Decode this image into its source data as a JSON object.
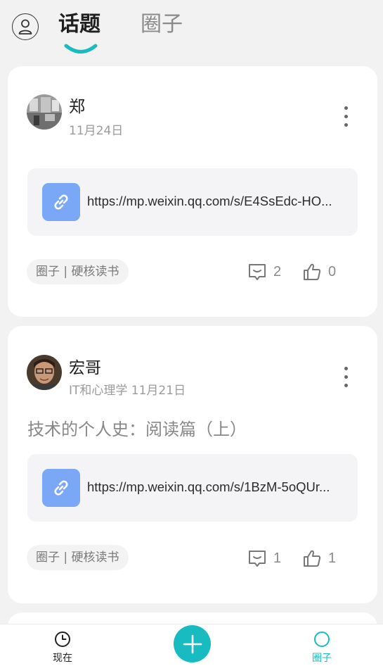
{
  "header": {
    "tabs": [
      {
        "label": "话题",
        "active": true
      },
      {
        "label": "圈子",
        "active": false
      }
    ],
    "profile_icon": "user-icon"
  },
  "posts": [
    {
      "author": "郑",
      "meta": "11月24日",
      "title": "",
      "link_url": "https://mp.weixin.qq.com/s/E4SsEdc-HO...",
      "circle_tag": "圈子 | 硬核读书",
      "comments": "2",
      "likes": "0"
    },
    {
      "author": "宏哥",
      "meta": "IT和心理学 11月21日",
      "title": "技术的个人史：阅读篇（上）",
      "link_url": "https://mp.weixin.qq.com/s/1BzM-5oQUr...",
      "circle_tag": "圈子 | 硬核读书",
      "comments": "1",
      "likes": "1"
    }
  ],
  "bottom_nav": {
    "items": [
      {
        "label": "现在",
        "icon": "clock-icon",
        "active": false
      },
      {
        "label": "圈子",
        "icon": "circle-icon",
        "active": true
      }
    ],
    "add_icon": "plus-icon"
  },
  "colors": {
    "accent": "#18bcc0",
    "link_icon_bg": "#7aa8f7",
    "page_bg": "#f2f2f2"
  }
}
